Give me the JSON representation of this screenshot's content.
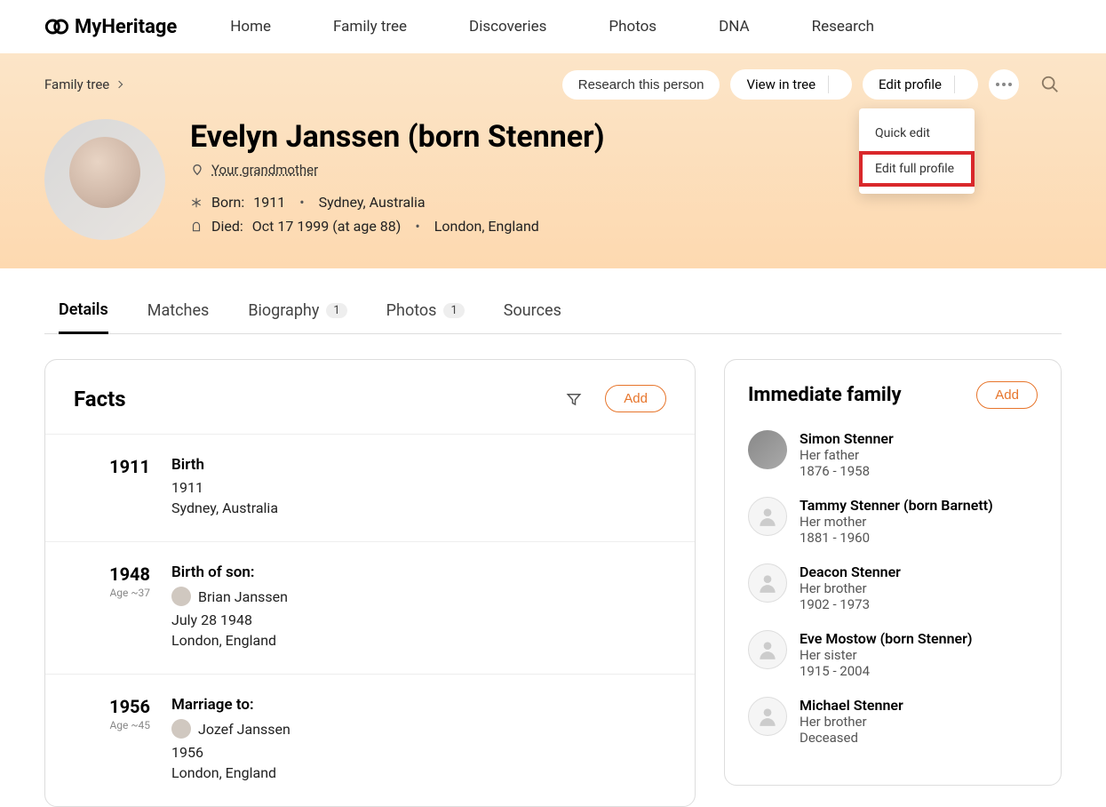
{
  "nav": {
    "brand": "MyHeritage",
    "items": [
      "Home",
      "Family tree",
      "Discoveries",
      "Photos",
      "DNA",
      "Research"
    ]
  },
  "breadcrumb": "Family tree",
  "actions": {
    "research": "Research this person",
    "view_in_tree": "View in tree",
    "edit_profile": "Edit profile",
    "menu": {
      "quick_edit": "Quick edit",
      "edit_full": "Edit full profile"
    }
  },
  "person": {
    "name": "Evelyn Janssen (born Stenner)",
    "relation": "Your grandmother",
    "born_label": "Born:",
    "born_year": "1911",
    "born_place": "Sydney, Australia",
    "died_label": "Died:",
    "died_date": "Oct 17 1999 (at age 88)",
    "died_place": "London, England"
  },
  "tabs": {
    "details": "Details",
    "matches": "Matches",
    "biography": "Biography",
    "biography_count": "1",
    "photos": "Photos",
    "photos_count": "1",
    "sources": "Sources"
  },
  "facts": {
    "heading": "Facts",
    "add": "Add",
    "items": [
      {
        "year": "1911",
        "age": "",
        "title": "Birth",
        "person": "",
        "line1": "1911",
        "line2": "Sydney, Australia"
      },
      {
        "year": "1948",
        "age": "Age ~37",
        "title": "Birth of son:",
        "person": "Brian Janssen",
        "line1": "July 28 1948",
        "line2": "London, England"
      },
      {
        "year": "1956",
        "age": "Age ~45",
        "title": "Marriage to:",
        "person": "Jozef Janssen",
        "line1": "1956",
        "line2": "London, England"
      }
    ]
  },
  "family": {
    "heading": "Immediate family",
    "add": "Add",
    "members": [
      {
        "name": "Simon Stenner",
        "rel": "Her father",
        "dates": "1876 - 1958",
        "photo": true
      },
      {
        "name": "Tammy Stenner (born Barnett)",
        "rel": "Her mother",
        "dates": "1881 - 1960",
        "photo": false
      },
      {
        "name": "Deacon Stenner",
        "rel": "Her brother",
        "dates": "1902 - 1973",
        "photo": false
      },
      {
        "name": "Eve Mostow (born Stenner)",
        "rel": "Her sister",
        "dates": "1915 - 2004",
        "photo": false
      },
      {
        "name": "Michael Stenner",
        "rel": "Her brother",
        "dates": "Deceased",
        "photo": false
      }
    ]
  }
}
